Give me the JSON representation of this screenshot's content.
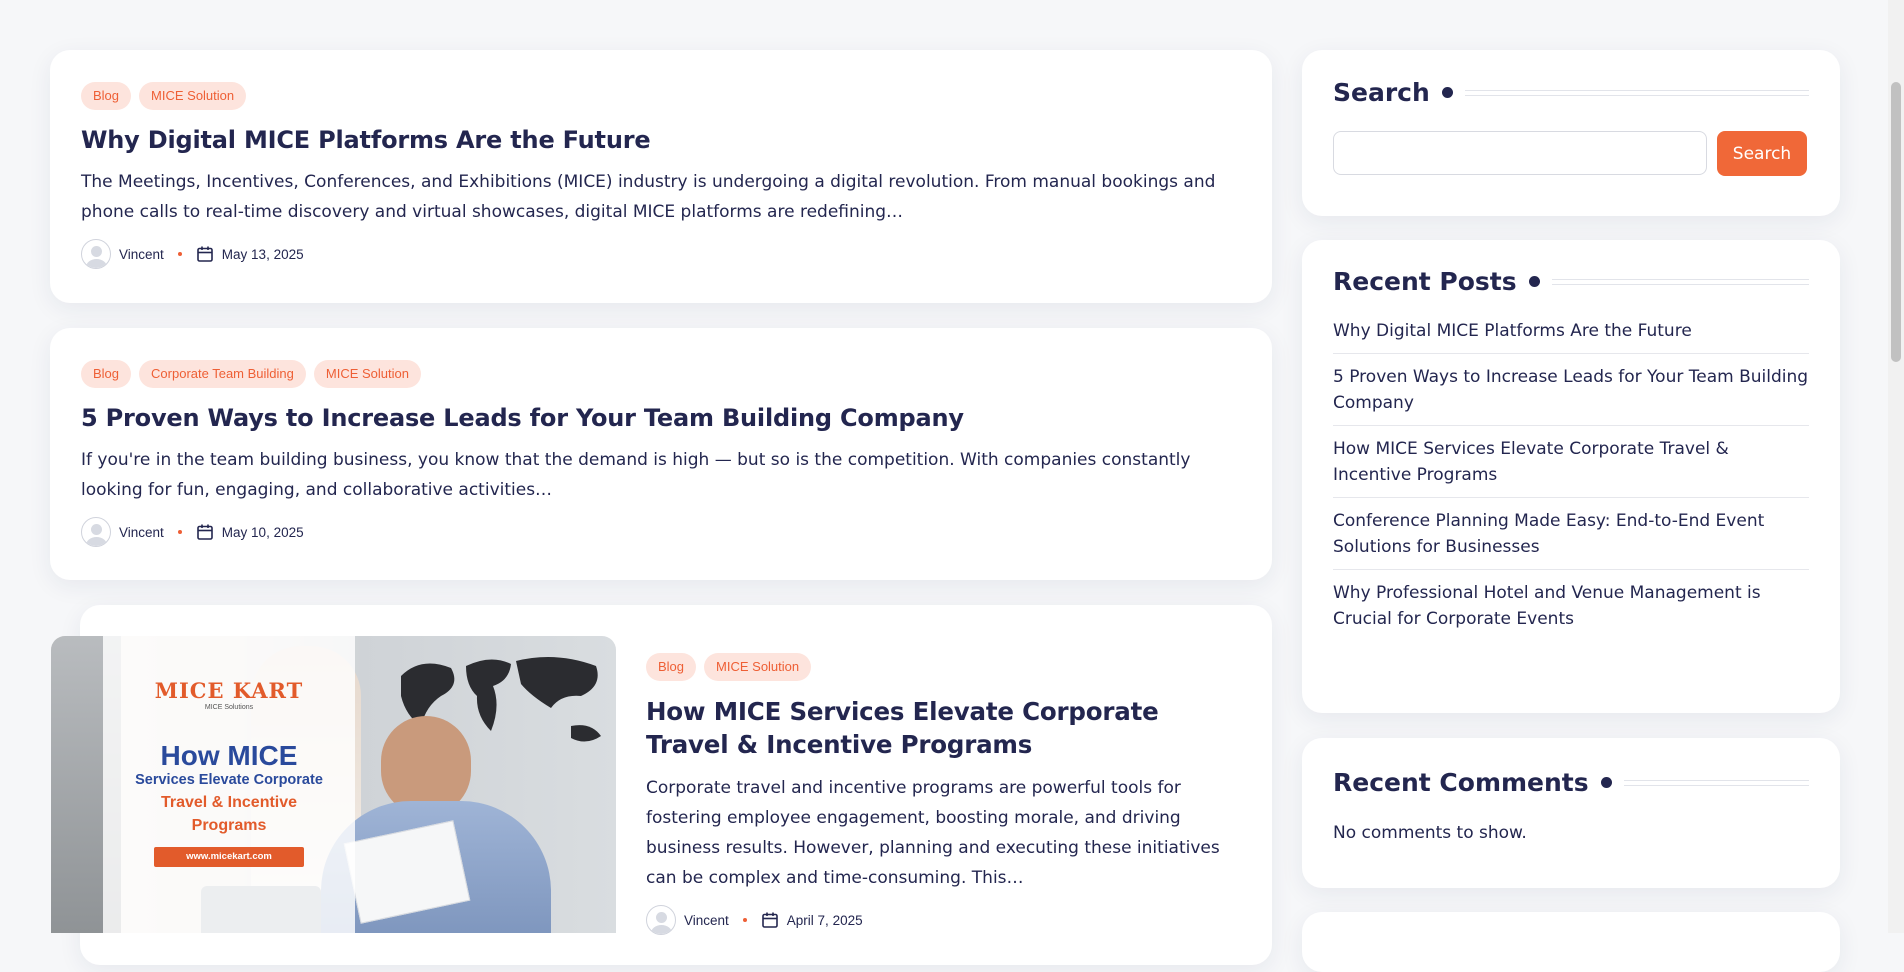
{
  "posts": [
    {
      "tags": [
        "Blog",
        "MICE Solution"
      ],
      "title": "Why Digital MICE Platforms Are the Future",
      "excerpt": "The Meetings, Incentives, Conferences, and Exhibitions (MICE) industry is undergoing a digital revolution. From manual bookings and phone calls to real-time discovery and virtual showcases, digital MICE platforms are redefining…",
      "author": "Vincent",
      "date": "May 13, 2025"
    },
    {
      "tags": [
        "Blog",
        "Corporate Team Building",
        "MICE Solution"
      ],
      "title": "5 Proven Ways to Increase Leads for Your Team Building Company",
      "excerpt": "If you're in the team building business, you know that the demand is high — but so is the competition. With companies constantly looking for fun, engaging, and collaborative activities…",
      "author": "Vincent",
      "date": "May 10, 2025"
    },
    {
      "tags": [
        "Blog",
        "MICE Solution"
      ],
      "title": "How MICE Services Elevate Corporate Travel & Incentive Programs",
      "excerpt": "Corporate travel and incentive programs are powerful tools for fostering employee engagement, boosting morale, and driving business results. However, planning and executing these initiatives can be complex and time-consuming. This…",
      "author": "Vincent",
      "date": "April 7, 2025",
      "thumbnail": {
        "logo": "MICE KART",
        "logo_sub": "MICE Solutions",
        "headline": "How MICE",
        "sub1": "Services Elevate Corporate",
        "sub2": "Travel & Incentive",
        "sub3": "Programs",
        "url": "www.micekart.com"
      }
    }
  ],
  "sidebar": {
    "search": {
      "title": "Search",
      "placeholder": "",
      "button": "Search"
    },
    "recent_posts": {
      "title": "Recent Posts",
      "items": [
        "Why Digital MICE Platforms Are the Future",
        "5 Proven Ways to Increase Leads for Your Team Building Company",
        "How MICE Services Elevate Corporate Travel & Incentive Programs",
        "Conference Planning Made Easy: End-to-End Event Solutions for Businesses",
        "Why Professional Hotel and Venue Management is Crucial for Corporate Events"
      ]
    },
    "recent_comments": {
      "title": "Recent Comments",
      "empty": "No comments to show."
    }
  },
  "colors": {
    "accent": "#f06838",
    "tag_bg": "#fde4dd",
    "text": "#23264f",
    "page_bg": "#f6f7f9"
  }
}
